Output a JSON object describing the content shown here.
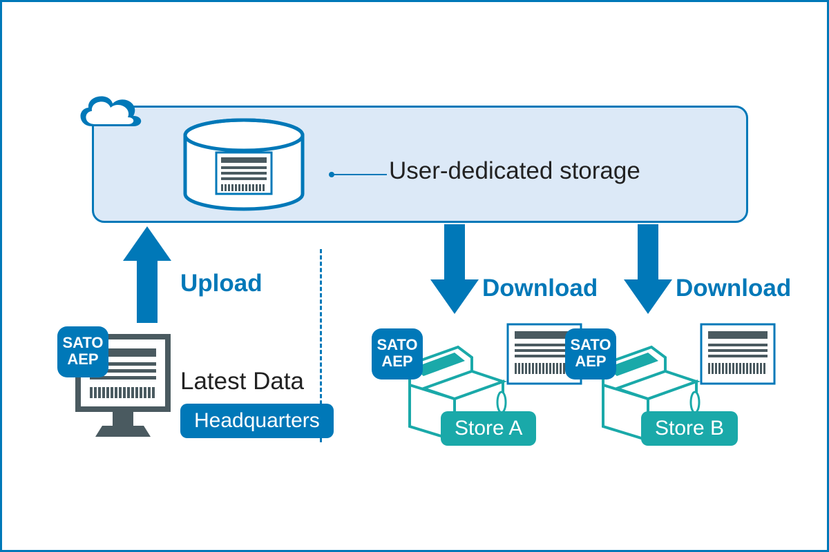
{
  "storage_label": "User-dedicated storage",
  "upload_label": "Upload",
  "download_label": "Download",
  "latest_data": "Latest Data",
  "hq": "Headquarters",
  "store_a": "Store A",
  "store_b": "Store B",
  "sato_line1": "SATO",
  "sato_line2": "AEP",
  "colors": {
    "blue": "#0078B8",
    "teal": "#1AA9A9",
    "light": "#DCE9F7",
    "slate": "#4A5A60"
  }
}
